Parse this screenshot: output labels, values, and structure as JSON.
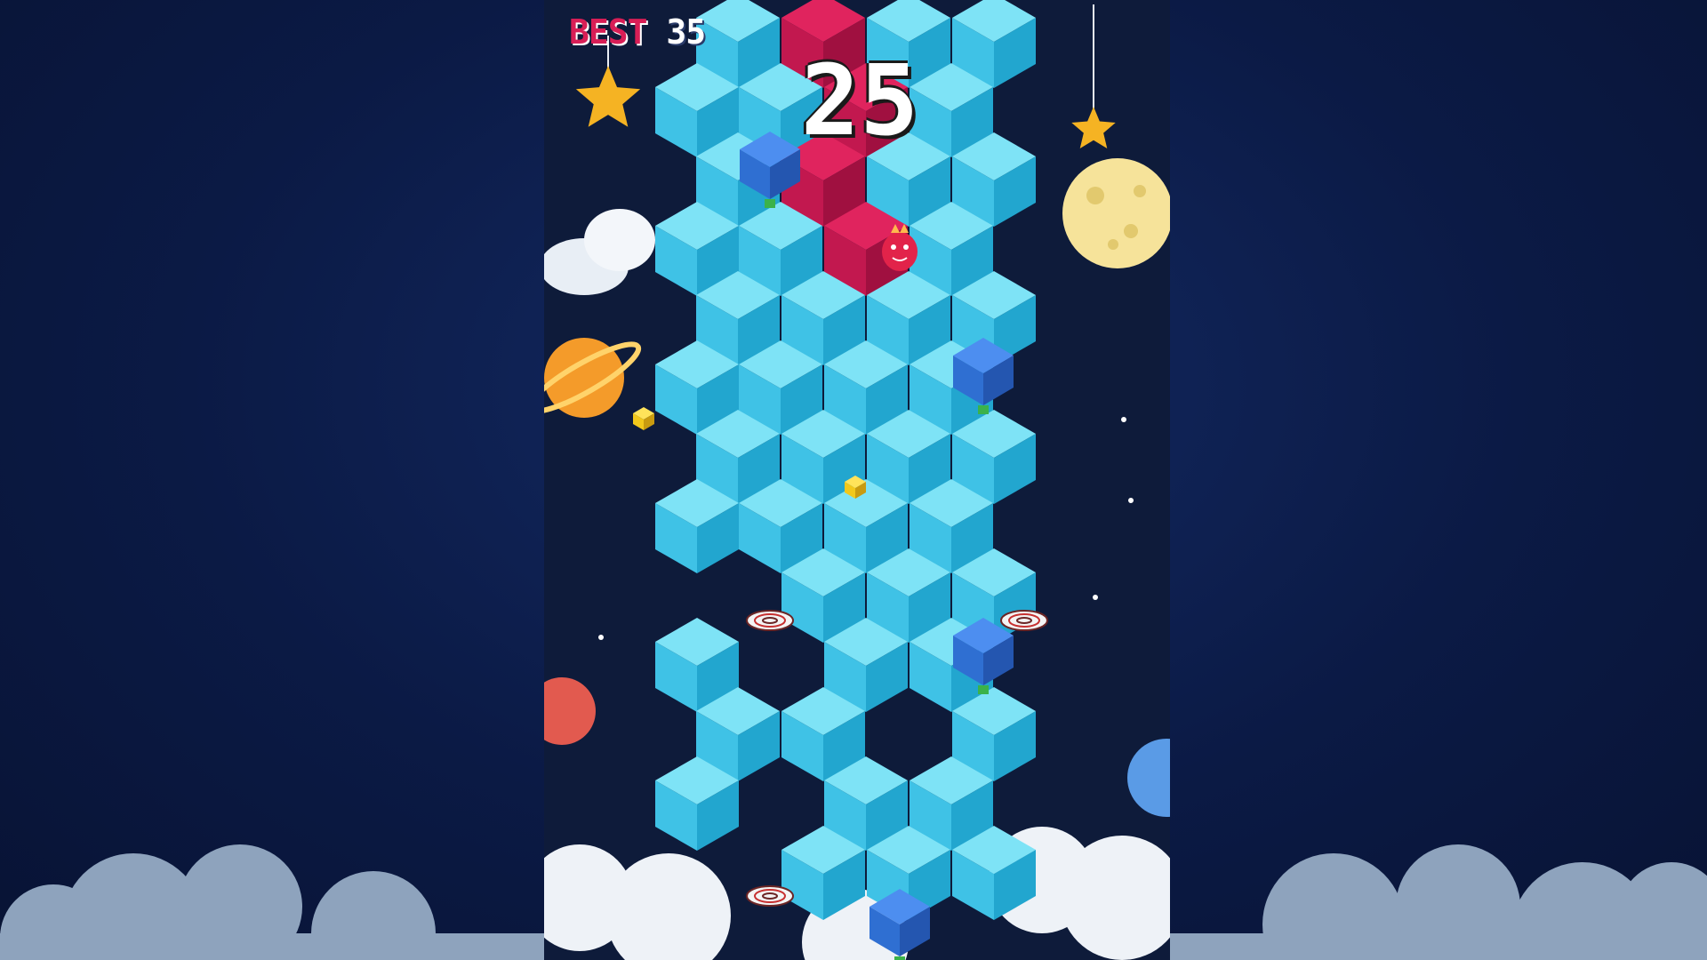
{
  "hud": {
    "best_label": "BEST",
    "best_value": "35",
    "score": "25"
  },
  "colors": {
    "background": "#0b1a45",
    "tile_top": "#7ee3f6",
    "tile_left": "#3fc2e6",
    "tile_right": "#22a6cf",
    "path_top": "#e0245e",
    "path_left": "#c2184f",
    "path_right": "#a01040",
    "obstacle": "#2f6fd2",
    "coin": "#f2c81b",
    "player": "#e2234a"
  },
  "icons": {
    "player": "red-blob-character",
    "coin": "gold-cube-coin",
    "hazard": "spiral-trap",
    "obstacle": "blue-block"
  }
}
